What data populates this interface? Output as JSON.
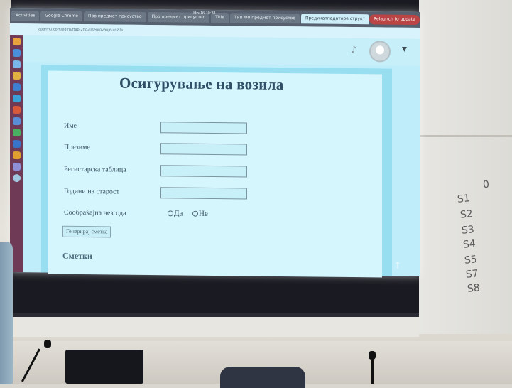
{
  "browser": {
    "tabs": [
      "Activities",
      "Google Chrome",
      "Про предмет присуство",
      "Про предмет присуство",
      "Title",
      "Тип Ф0 предмет присуство",
      "Про предмет присуство",
      "Предикатпадаторе структ"
    ],
    "clock": "Hrs 16 10:28",
    "address": "aparmu.com/edirp/ftap-2nd2l/seurovanje-vozila",
    "update_button": "Relaunch to update"
  },
  "header": {
    "bell_icon": "bell-icon",
    "avatar_icon": "user-avatar-icon",
    "caret_icon": "caret-down-icon"
  },
  "form": {
    "title": "Осигурување на возила",
    "fields": [
      {
        "label": "Име",
        "value": "",
        "placeholder": ""
      },
      {
        "label": "Презиме",
        "value": "",
        "placeholder": ""
      },
      {
        "label": "Регистарска таблица",
        "value": "",
        "placeholder": ""
      },
      {
        "label": "Години на старост",
        "value": "",
        "placeholder": ""
      }
    ],
    "accident_label": "Сообраќајна незгода",
    "radio_yes": "Да",
    "radio_no": "Не",
    "generate_button": "Генерирај сметка",
    "bills_heading": "Сметки"
  },
  "whiteboard": {
    "notes": [
      "0",
      "S1",
      "S2",
      "S3",
      "S4",
      "S5",
      "S7",
      "S8"
    ]
  },
  "colors": {
    "projection_bg": "#bfeefa",
    "card_bg": "#d5f6fd",
    "title_color": "#2e4f66"
  }
}
